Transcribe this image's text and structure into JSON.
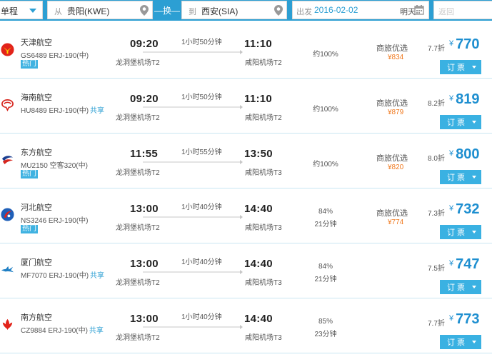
{
  "search": {
    "trip_type": "单程",
    "from_prefix": "从",
    "from_city": "贵阳(KWE)",
    "swap_label": "—换—",
    "to_prefix": "到",
    "to_city": "西安(SIA)",
    "date_prefix": "出发",
    "date": "2016-02-02",
    "date_hint": "明天",
    "return_placeholder": "返回"
  },
  "colors": {
    "brand_blue": "#2c9fd3",
    "price_blue": "#1e8fd0",
    "promo_orange": "#f07a20",
    "button_blue": "#3ab1e2"
  },
  "book_label": "订 票",
  "flights": [
    {
      "airline": "天津航空",
      "logo_icon": "tianjin-airlines-logo",
      "flight_no": "GS6489 ERJ-190(中)",
      "share": "",
      "hot": "热门",
      "dep_time": "09:20",
      "dep_airport": "龙洞堡机场T2",
      "duration": "1小时50分钟",
      "arr_time": "11:10",
      "arr_airport": "咸阳机场T2",
      "ontime": "约100%",
      "delay": "",
      "promo": "商旅优选",
      "promo_price": "¥834",
      "discount": "7.7折",
      "currency": "¥",
      "price": "770"
    },
    {
      "airline": "海南航空",
      "logo_icon": "hainan-airlines-logo",
      "flight_no": "HU8489 ERJ-190(中)",
      "share": "共享",
      "hot": "",
      "dep_time": "09:20",
      "dep_airport": "龙洞堡机场T2",
      "duration": "1小时50分钟",
      "arr_time": "11:10",
      "arr_airport": "咸阳机场T2",
      "ontime": "约100%",
      "delay": "",
      "promo": "商旅优选",
      "promo_price": "¥879",
      "discount": "8.2折",
      "currency": "¥",
      "price": "819"
    },
    {
      "airline": "东方航空",
      "logo_icon": "china-eastern-logo",
      "flight_no": "MU2150 空客320(中)",
      "share": "",
      "hot": "热门",
      "dep_time": "11:55",
      "dep_airport": "龙洞堡机场T2",
      "duration": "1小时55分钟",
      "arr_time": "13:50",
      "arr_airport": "咸阳机场T3",
      "ontime": "约100%",
      "delay": "",
      "promo": "商旅优选",
      "promo_price": "¥820",
      "discount": "8.0折",
      "currency": "¥",
      "price": "800"
    },
    {
      "airline": "河北航空",
      "logo_icon": "hebei-airlines-logo",
      "flight_no": "NS3246 ERJ-190(中)",
      "share": "",
      "hot": "热门",
      "dep_time": "13:00",
      "dep_airport": "龙洞堡机场T2",
      "duration": "1小时40分钟",
      "arr_time": "14:40",
      "arr_airport": "咸阳机场T3",
      "ontime": "84%",
      "delay": "21分钟",
      "promo": "商旅优选",
      "promo_price": "¥774",
      "discount": "7.3折",
      "currency": "¥",
      "price": "732"
    },
    {
      "airline": "厦门航空",
      "logo_icon": "xiamen-airlines-logo",
      "flight_no": "MF7070 ERJ-190(中)",
      "share": "共享",
      "hot": "",
      "dep_time": "13:00",
      "dep_airport": "龙洞堡机场T2",
      "duration": "1小时40分钟",
      "arr_time": "14:40",
      "arr_airport": "咸阳机场T3",
      "ontime": "84%",
      "delay": "21分钟",
      "promo": "",
      "promo_price": "",
      "discount": "7.5折",
      "currency": "¥",
      "price": "747"
    },
    {
      "airline": "南方航空",
      "logo_icon": "china-southern-logo",
      "flight_no": "CZ9884 ERJ-190(中)",
      "share": "共享",
      "hot": "",
      "dep_time": "13:00",
      "dep_airport": "龙洞堡机场T2",
      "duration": "1小时40分钟",
      "arr_time": "14:40",
      "arr_airport": "咸阳机场T3",
      "ontime": "85%",
      "delay": "23分钟",
      "promo": "",
      "promo_price": "",
      "discount": "7.7折",
      "currency": "¥",
      "price": "773"
    }
  ]
}
